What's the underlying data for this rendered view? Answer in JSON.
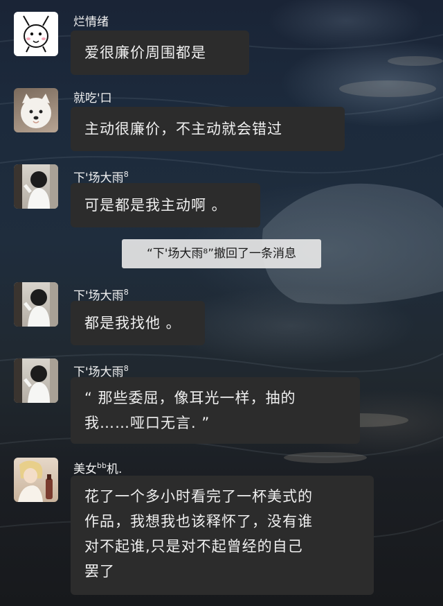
{
  "messages": [
    {
      "sender": "烂情绪",
      "text": "爱很廉价周围都是",
      "avatar_icon": "cartoon-rabbit-icon"
    },
    {
      "sender": "就吃'口",
      "text": "主动很廉价，不主动就会错过",
      "avatar_icon": "white-dog-photo"
    },
    {
      "sender_base": "下'场大雨",
      "sender_sup": "8",
      "text": "可是都是我主动啊 。",
      "avatar_icon": "girl-photo"
    },
    {
      "sender_base": "下'场大雨",
      "sender_sup": "8",
      "text": "都是我找他 。",
      "avatar_icon": "girl-photo"
    },
    {
      "sender_base": "下'场大雨",
      "sender_sup": "8",
      "text_lines": [
        "“ 那些委屈，像耳光一样，抽的",
        "我……哑口无言. ”"
      ],
      "avatar_icon": "girl-photo"
    },
    {
      "sender_base": "美女",
      "sender_sup": "bb",
      "sender_tail": "机.",
      "text_lines": [
        "花了一个多小时看完了一杯美式的",
        "作品，我想我也该释怀了，没有谁",
        "对不起谁,只是对不起曾经的自己",
        "罢了"
      ],
      "avatar_icon": "blonde-girl-photo"
    }
  ],
  "system_notice": "“下'场大雨⁸”撤回了一条消息",
  "colors": {
    "bubble": "#2c2c2c",
    "bubble_text": "#f0f0f0",
    "system_bg": "#e6e6e6"
  }
}
